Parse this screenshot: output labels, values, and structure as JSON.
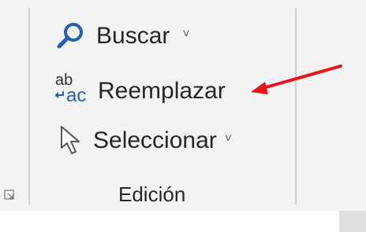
{
  "ribbon_group": {
    "label": "Edición",
    "commands": {
      "search": {
        "label": "Buscar",
        "icon": "magnifier-icon",
        "has_dropdown": true
      },
      "replace": {
        "label": "Reemplazar",
        "icon": "replace-abac-icon",
        "icon_text_top": "ab",
        "icon_text_bottom": "ac"
      },
      "select": {
        "label": "Seleccionar",
        "icon": "cursor-arrow-icon",
        "has_dropdown": true
      }
    },
    "dropdown_glyph": "˅"
  },
  "annotation": {
    "color": "#e8141b"
  },
  "colors": {
    "accent": "#1f5fb4",
    "ribbon_bg": "#f3f3f3",
    "text": "#262626"
  }
}
